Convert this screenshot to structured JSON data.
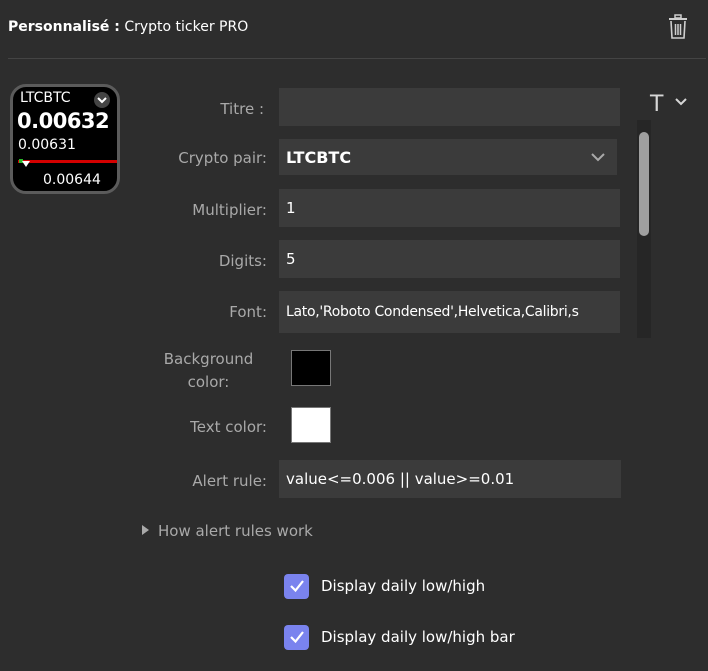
{
  "header": {
    "title_bold": "Personnalisé :",
    "title_rest": " Crypto ticker PRO",
    "trash_icon": "trash-icon"
  },
  "tile": {
    "symbol": "LTCBTC",
    "price": "0.00632",
    "low": "0.00631",
    "high": "0.00644",
    "bar_color": "#d40000"
  },
  "form": {
    "title_label": "Titre :",
    "title_value": "",
    "pair_label": "Crypto pair:",
    "pair_value": "LTCBTC",
    "multiplier_label": "Multiplier:",
    "multiplier_value": "1",
    "digits_label": "Digits:",
    "digits_value": "5",
    "font_label": "Font:",
    "font_value": "Lato,'Roboto Condensed',Helvetica,Calibri,s",
    "bg_label_line1": "Background",
    "bg_label_line2": "color:",
    "bg_color": "#000000",
    "text_color_label": "Text color:",
    "text_color": "#ffffff",
    "alert_label": "Alert rule:",
    "alert_value": "value<=0.006 || value>=0.01"
  },
  "expander": {
    "label": "How alert rules work"
  },
  "checkboxes": [
    {
      "label": "Display daily low/high",
      "checked": true
    },
    {
      "label": "Display daily low/high bar",
      "checked": true
    }
  ],
  "text_format_icon": "T",
  "accent_color": "#7a83ee"
}
